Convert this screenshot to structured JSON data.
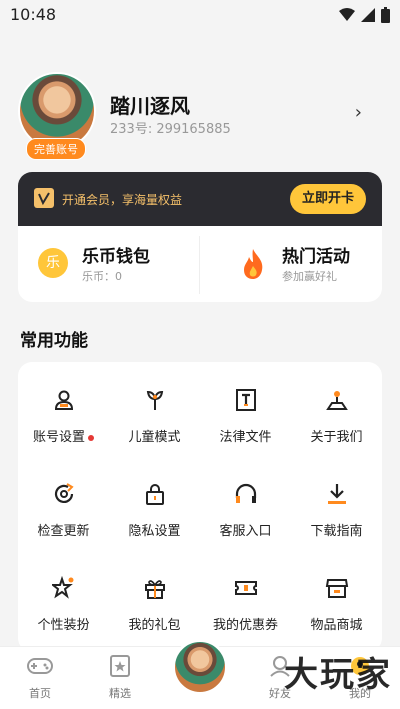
{
  "status_bar": {
    "time": "10:48"
  },
  "profile": {
    "name": "踏川逐风",
    "id_text": "233号: 299165885",
    "complete_badge": "完善账号"
  },
  "vip": {
    "text": "开通会员，享海量权益",
    "button": "立即开卡"
  },
  "wallet": {
    "title": "乐币钱包",
    "sub": "乐币：0",
    "coin_char": "乐"
  },
  "events": {
    "title": "热门活动",
    "sub": "参加赢好礼"
  },
  "section_title": "常用功能",
  "functions": [
    {
      "label": "账号设置",
      "icon": "account-settings-icon",
      "dot": true
    },
    {
      "label": "儿童模式",
      "icon": "child-mode-icon"
    },
    {
      "label": "法律文件",
      "icon": "legal-doc-icon"
    },
    {
      "label": "关于我们",
      "icon": "about-us-icon"
    },
    {
      "label": "检查更新",
      "icon": "check-update-icon"
    },
    {
      "label": "隐私设置",
      "icon": "privacy-lock-icon"
    },
    {
      "label": "客服入口",
      "icon": "headset-icon"
    },
    {
      "label": "下载指南",
      "icon": "download-icon"
    },
    {
      "label": "个性装扮",
      "icon": "dress-up-icon"
    },
    {
      "label": "我的礼包",
      "icon": "gift-icon"
    },
    {
      "label": "我的优惠券",
      "icon": "coupon-icon"
    },
    {
      "label": "物品商城",
      "icon": "shop-icon"
    }
  ],
  "nav": {
    "home": "首页",
    "featured": "精选",
    "friends": "好友",
    "me": "我的"
  },
  "watermark": "大玩家",
  "colors": {
    "accent": "#ffc63a",
    "orange": "#ff8a1e",
    "dark": "#2b2b30"
  }
}
